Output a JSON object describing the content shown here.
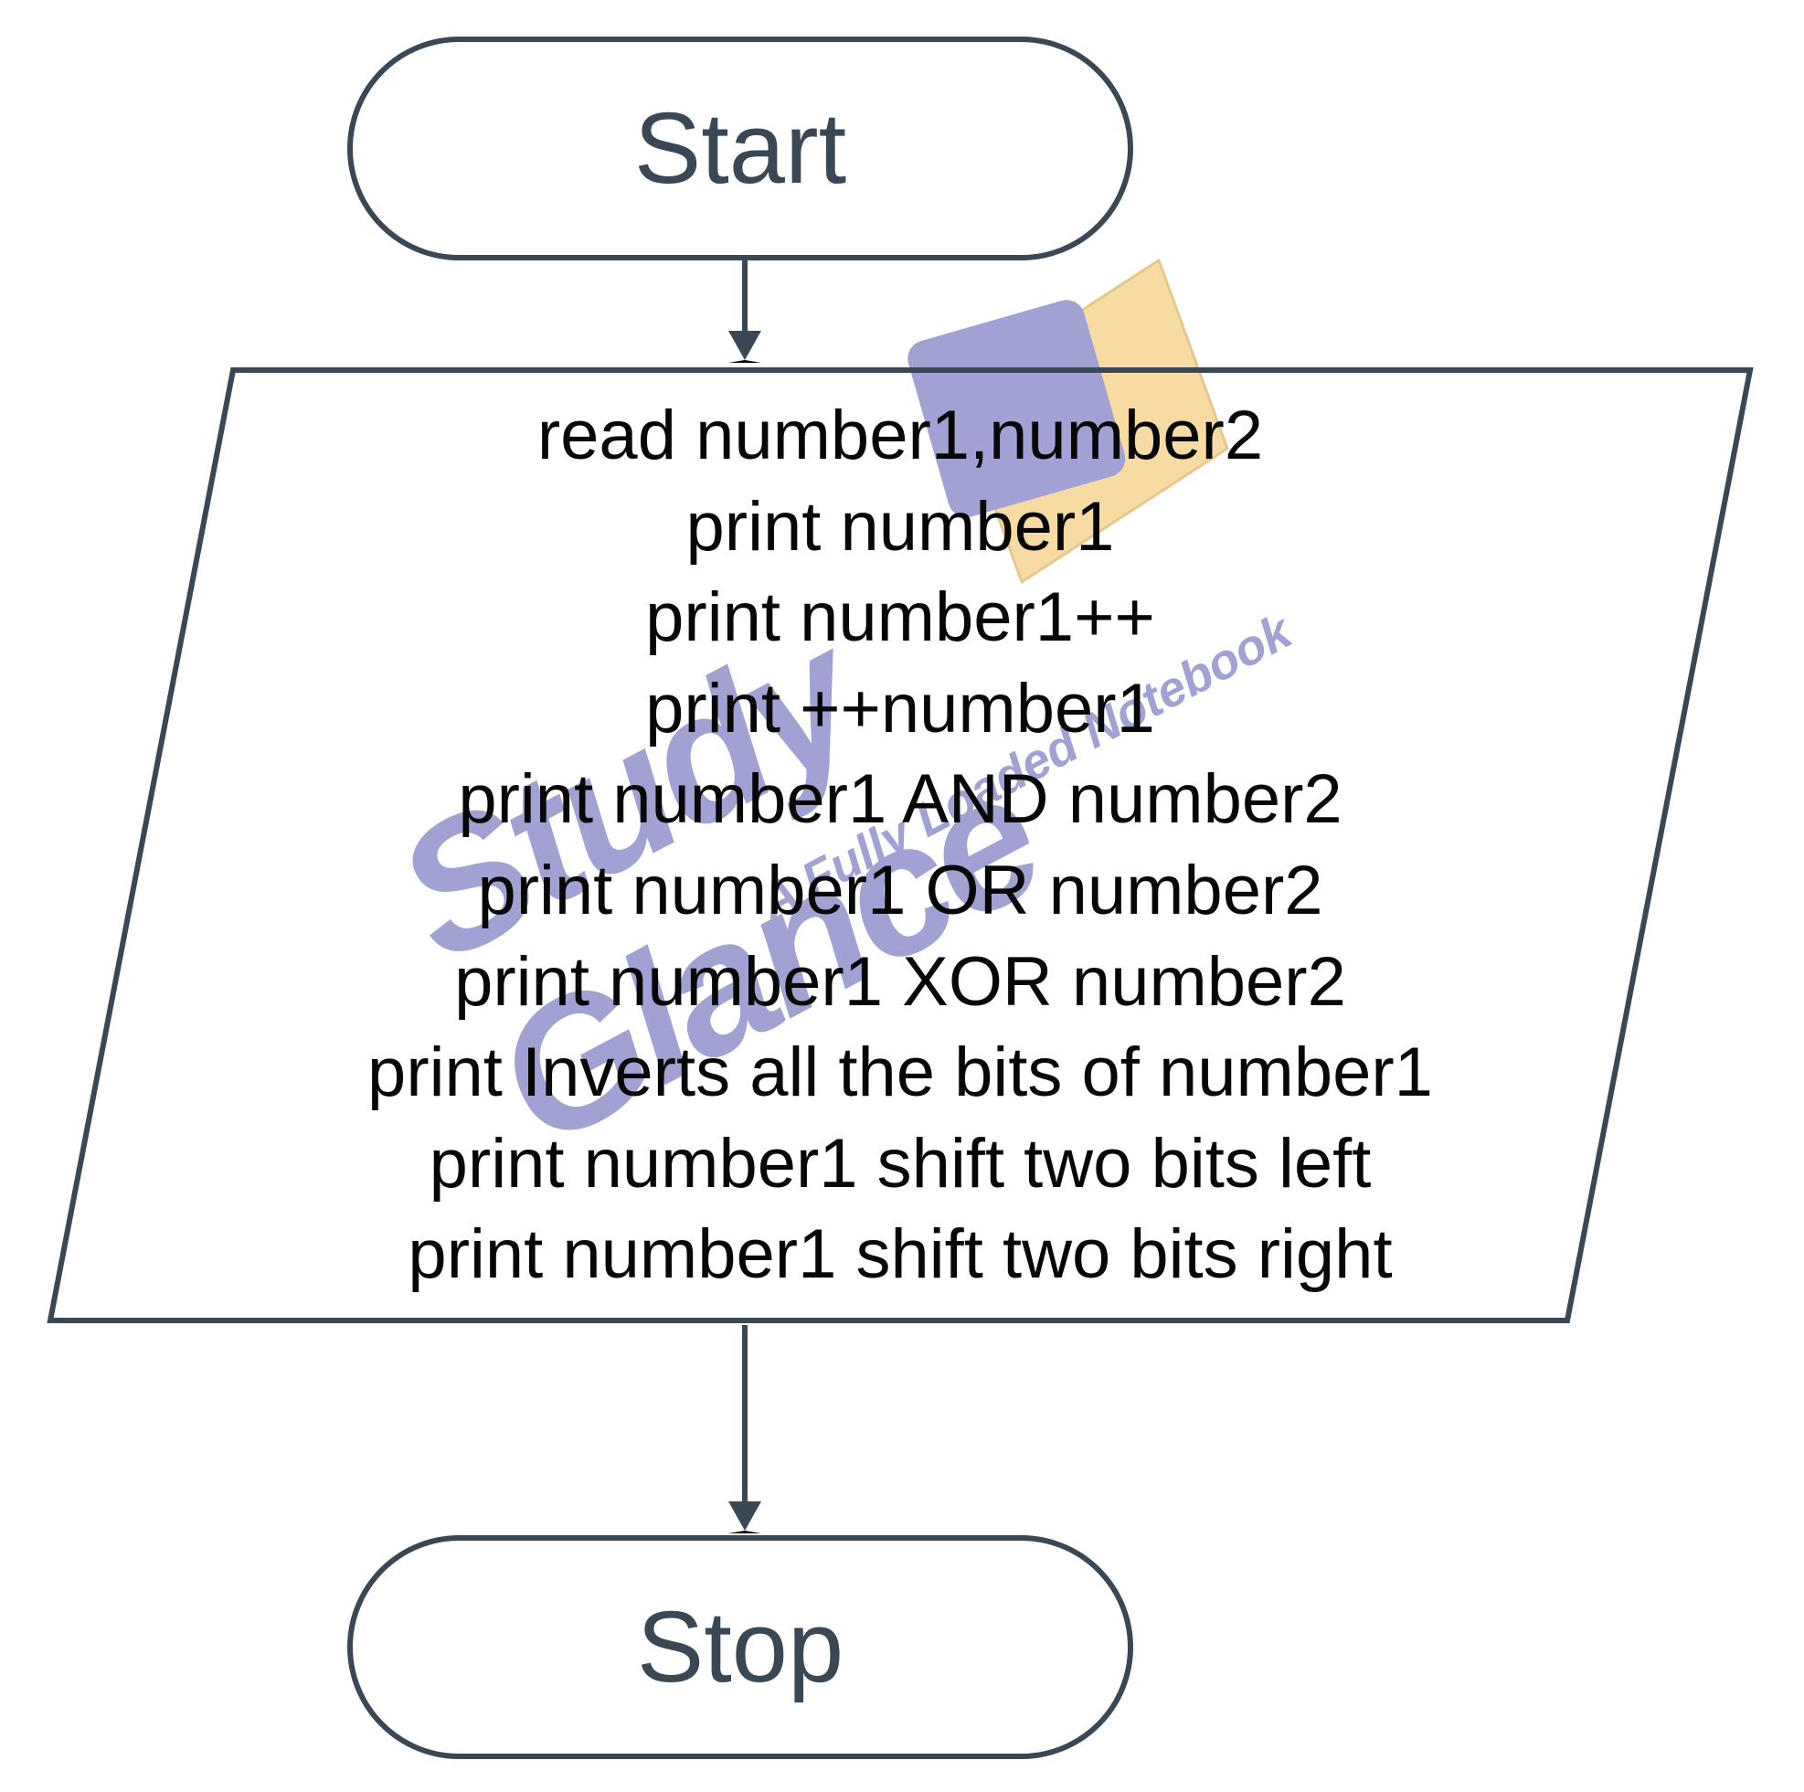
{
  "flowchart": {
    "start_label": "Start",
    "stop_label": "Stop",
    "process_lines": [
      "read number1,number2",
      "print number1",
      "print number1++",
      "print ++number1",
      "print number1 AND number2",
      "print number1 OR number2",
      "print number1 XOR number2",
      "print Inverts all the bits of number1",
      "print number1 shift two bits left",
      "print number1 shift two bits right"
    ]
  },
  "watermark": {
    "main": "Study Glance",
    "sub": "A Fully Loaded Notebook"
  }
}
